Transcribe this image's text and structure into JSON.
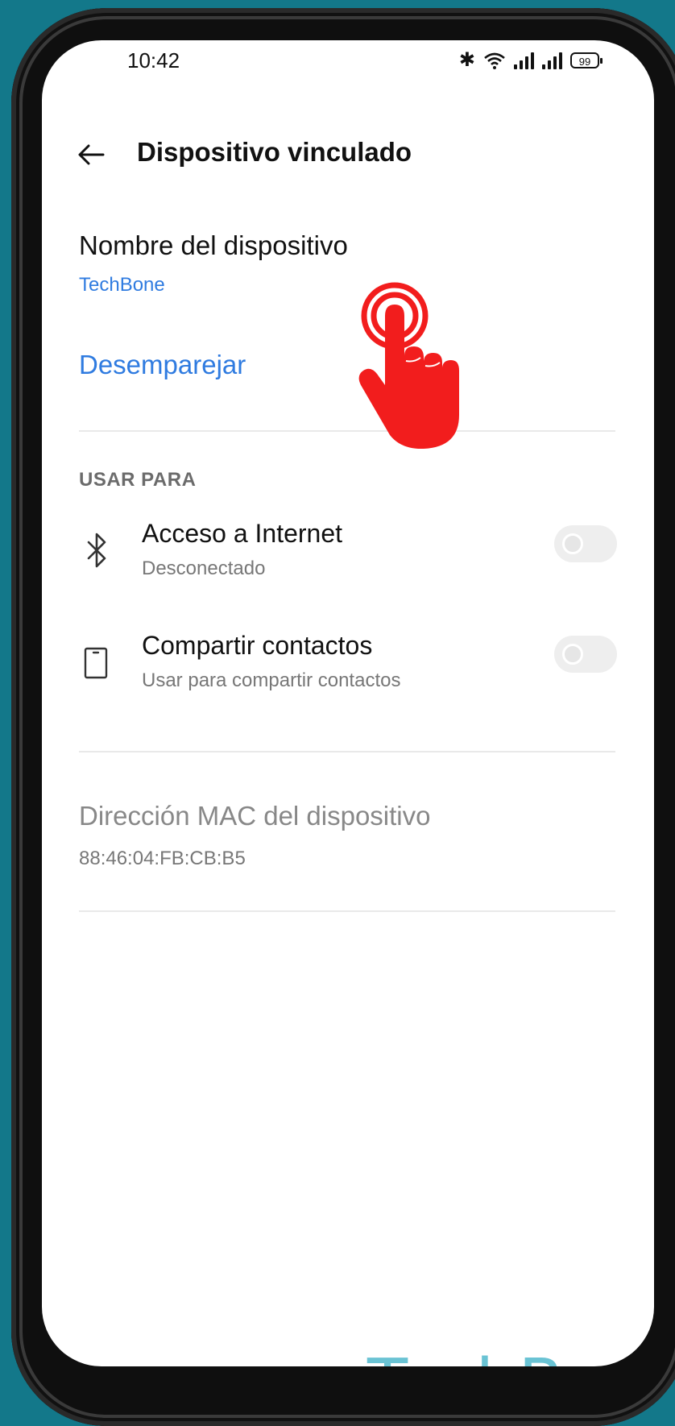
{
  "status_bar": {
    "time": "10:42",
    "battery": "99",
    "icons": [
      "bluetooth-icon",
      "wifi-icon",
      "signal-icon",
      "signal-icon",
      "battery-icon"
    ]
  },
  "header": {
    "title": "Dispositivo vinculado",
    "back_icon": "back-arrow-icon"
  },
  "device": {
    "name_label": "Nombre del dispositivo",
    "name_value": "TechBone",
    "unpair_label": "Desemparejar"
  },
  "use_for": {
    "section_label": "USAR PARA",
    "items": [
      {
        "title": "Acceso a Internet",
        "subtitle": "Desconectado",
        "icon": "bluetooth-icon",
        "enabled": false
      },
      {
        "title": "Compartir contactos",
        "subtitle": "Usar para compartir contactos",
        "icon": "phone-icon",
        "enabled": false
      }
    ]
  },
  "mac": {
    "label": "Dirección MAC del dispositivo",
    "value": "88:46:04:FB:CB:B5"
  },
  "overlay": {
    "tap_icon": "tap-hand-icon",
    "watermark": "TechBone"
  },
  "colors": {
    "background": "#13788a",
    "accent": "#2f7be0",
    "hand": "#f21d1d",
    "watermark": "#6ac3d4"
  }
}
